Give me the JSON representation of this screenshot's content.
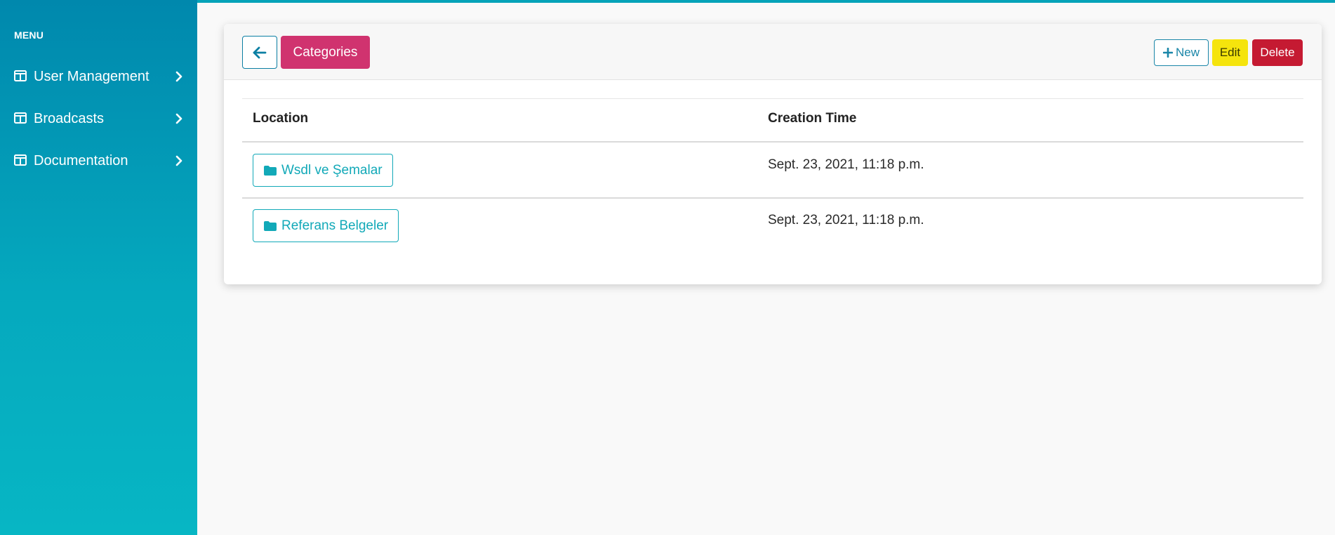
{
  "sidebar": {
    "heading": "MENU",
    "items": [
      {
        "label": "User Management",
        "icon": "table-columns-icon"
      },
      {
        "label": "Broadcasts",
        "icon": "table-columns-icon"
      },
      {
        "label": "Documentation",
        "icon": "table-columns-icon"
      }
    ]
  },
  "header": {
    "back_icon": "arrow-left-icon",
    "category_label": "Categories",
    "new_label": "New",
    "edit_label": "Edit",
    "delete_label": "Delete"
  },
  "table": {
    "columns": [
      "Location",
      "Creation Time"
    ],
    "rows": [
      {
        "location": "Wsdl ve Şemalar",
        "created": "Sept. 23, 2021, 11:18 p.m."
      },
      {
        "location": "Referans Belgeler",
        "created": "Sept. 23, 2021, 11:18 p.m."
      }
    ]
  },
  "colors": {
    "sidebar_top": "#0088ad",
    "sidebar_bottom": "#07b6c4",
    "category": "#d0336f",
    "edit": "#f5e40d",
    "delete": "#c51a32",
    "folder_link": "#12a9b8"
  }
}
